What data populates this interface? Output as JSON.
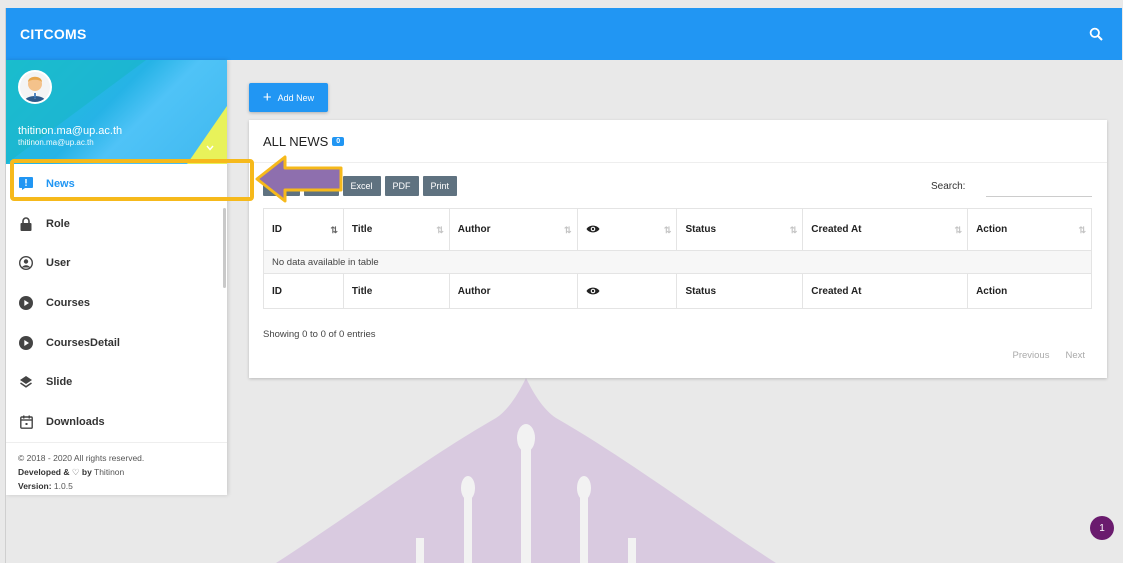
{
  "app": {
    "brand": "CITCOMS"
  },
  "user": {
    "name": "thitinon.ma@up.ac.th",
    "email": "thitinon.ma@up.ac.th"
  },
  "sidebar": {
    "items": [
      {
        "label": "News",
        "icon": "news-icon",
        "active": true
      },
      {
        "label": "Role",
        "icon": "lock-icon"
      },
      {
        "label": "User",
        "icon": "user-icon"
      },
      {
        "label": "Courses",
        "icon": "play-circle-icon"
      },
      {
        "label": "CoursesDetail",
        "icon": "play-circle-icon"
      },
      {
        "label": "Slide",
        "icon": "layers-icon"
      },
      {
        "label": "Downloads",
        "icon": "calendar-icon"
      }
    ],
    "footer": {
      "copyright": "© 2018 - 2020 All rights reserved.",
      "developed_label": "Developed &",
      "developed_by": "by",
      "developer": "Thitinon",
      "version_label": "Version:",
      "version": "1.0.5"
    }
  },
  "toolbar": {
    "add_label": "Add New"
  },
  "card": {
    "title": "ALL NEWS",
    "count": "0",
    "buttons": [
      "Copy",
      "CSV",
      "Excel",
      "PDF",
      "Print"
    ],
    "search_label": "Search:",
    "search_value": "",
    "columns": [
      "ID",
      "Title",
      "Author",
      "",
      "Status",
      "Created At",
      "Action"
    ],
    "empty_message": "No data available in table",
    "info": "Showing 0 to 0 of 0 entries",
    "previous": "Previous",
    "next": "Next"
  },
  "notification": {
    "count": "1"
  },
  "colors": {
    "primary": "#2196f3",
    "highlight": "#f6b91b",
    "arrow": "#8e6fae"
  }
}
